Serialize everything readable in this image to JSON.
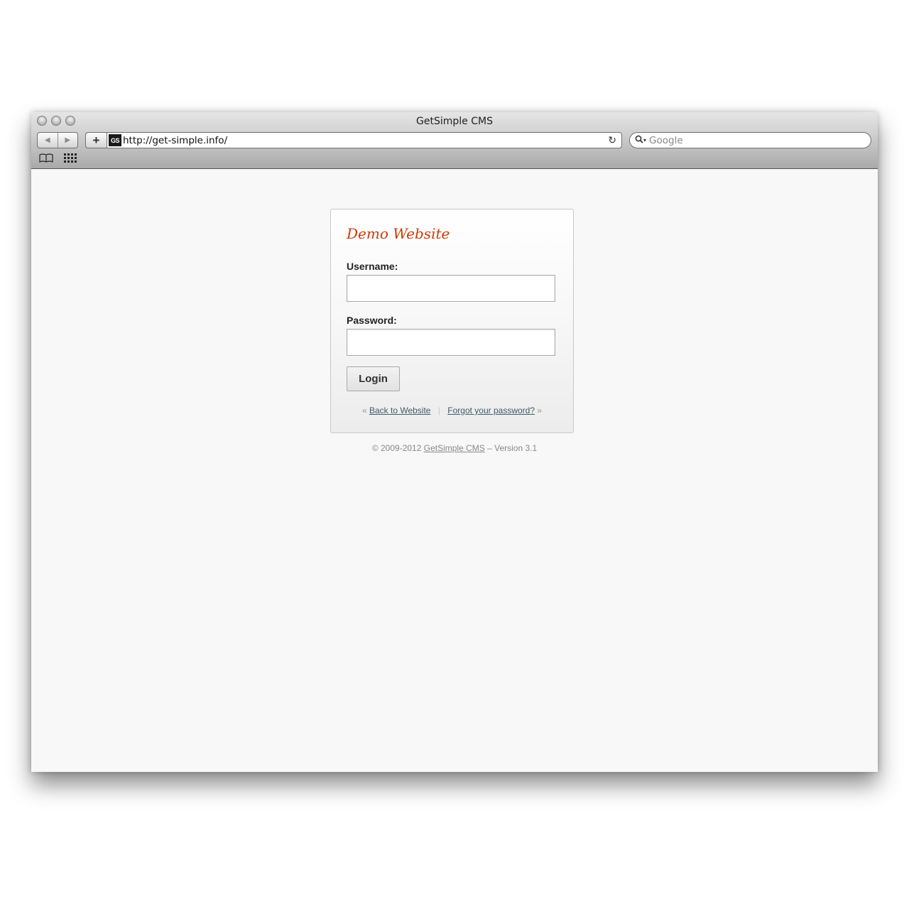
{
  "browser": {
    "window_title": "GetSimple CMS",
    "url": "http://get-simple.info/",
    "favicon_text": "GS",
    "search_placeholder": "Google",
    "add_label": "+",
    "back_label": "◀",
    "forward_label": "▶",
    "reload_label": "↻",
    "icons": {
      "back": "back-arrow-icon",
      "forward": "forward-arrow-icon",
      "reload": "reload-icon",
      "search": "magnifier-icon",
      "bookmarks": "book-icon",
      "top_sites": "grid-icon"
    }
  },
  "login": {
    "site_title": "Demo Website",
    "username_label": "Username:",
    "username_value": "",
    "password_label": "Password:",
    "password_value": "",
    "login_button": "Login",
    "back_prefix": "«",
    "back_link": "Back to Website",
    "separator": "|",
    "forgot_link": "Forgot your password?",
    "forgot_suffix": "»"
  },
  "footer": {
    "copyright": "© 2009-2012",
    "cms_link": "GetSimple CMS",
    "version": "– Version 3.1"
  },
  "colors": {
    "title_accent": "#cf3805",
    "link": "#415a66",
    "page_background": "#f8f8f8"
  }
}
